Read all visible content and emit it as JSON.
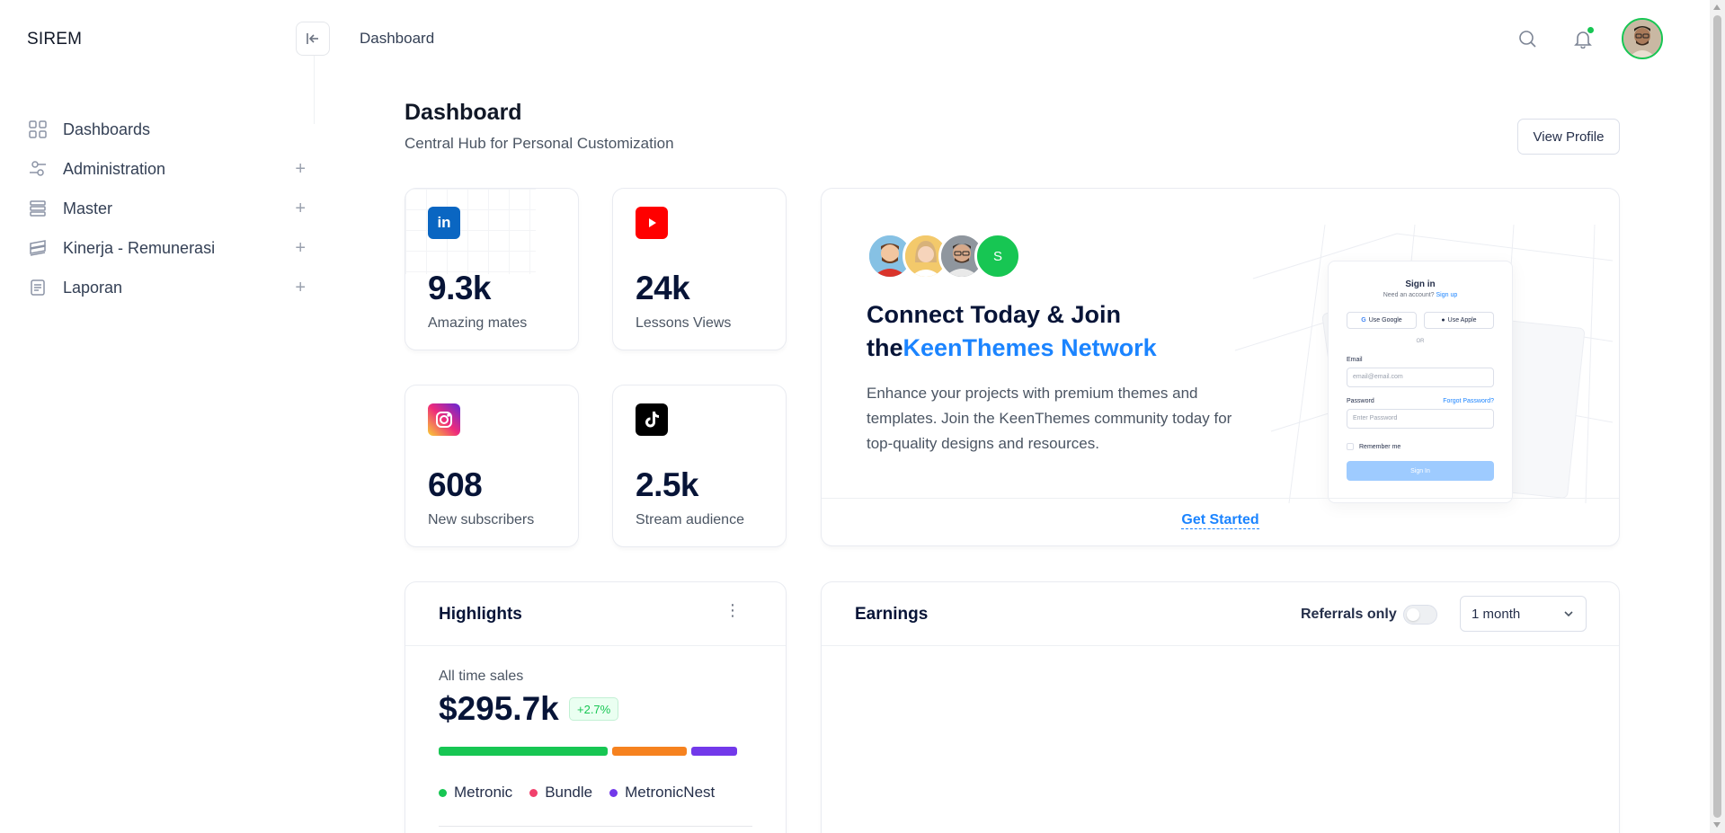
{
  "brand": "SIREM",
  "topbar": {
    "title": "Dashboard"
  },
  "sidebar": {
    "items": [
      {
        "label": "Dashboards",
        "icon": "grid-icon",
        "expandable": false
      },
      {
        "label": "Administration",
        "icon": "sliders-icon",
        "expandable": true
      },
      {
        "label": "Master",
        "icon": "stack-icon",
        "expandable": true
      },
      {
        "label": "Kinerja - Remunerasi",
        "icon": "layers-icon",
        "expandable": true
      },
      {
        "label": "Laporan",
        "icon": "document-icon",
        "expandable": true
      }
    ],
    "expand_symbol": "+"
  },
  "page": {
    "title": "Dashboard",
    "subtitle": "Central Hub for Personal Customization",
    "view_profile": "View Profile"
  },
  "stats": [
    {
      "value": "9.3k",
      "label": "Amazing mates",
      "icon": "linkedin-icon",
      "color": "#0a66c2"
    },
    {
      "value": "24k",
      "label": "Lessons Views",
      "icon": "youtube-icon",
      "color": "#ff0000"
    },
    {
      "value": "608",
      "label": "New subscribers",
      "icon": "instagram-icon",
      "color": "#e1306c"
    },
    {
      "value": "2.5k",
      "label": "Stream audience",
      "icon": "tiktok-icon",
      "color": "#000000"
    }
  ],
  "promo": {
    "title_line1": "Connect Today & Join",
    "title_prefix": "the",
    "title_accent": "KeenThemes Network",
    "text": "Enhance your projects with premium themes and templates. Join the KeenThemes community today for top-quality designs and resources.",
    "cta": "Get Started",
    "avatar_initial": "S",
    "signin": {
      "title": "Sign in",
      "subtitle": "Need an account?",
      "signup": "Sign up",
      "google": "Use Google",
      "apple": "Use Apple",
      "or": "OR",
      "email_label": "Email",
      "email_placeholder": "email@email.com",
      "password_label": "Password",
      "forgot": "Forgot Password?",
      "password_placeholder": "Enter Password",
      "remember": "Remember me",
      "submit": "Sign In"
    }
  },
  "highlights": {
    "title": "Highlights",
    "label": "All time sales",
    "value": "$295.7k",
    "badge": "+2.7%",
    "legend": [
      {
        "name": "Metronic",
        "color": "#17c653",
        "share": 0.555
      },
      {
        "name": "Bundle",
        "color": "#f1416c",
        "share": 0.245
      },
      {
        "name": "MetronicNest",
        "color": "#7239ea",
        "share": 0.15
      }
    ],
    "bar_colors": [
      "#17c653",
      "#f6821f",
      "#7239ea"
    ]
  },
  "earnings": {
    "title": "Earnings",
    "referrals_label": "Referrals only",
    "referrals_on": false,
    "period": "1 month"
  },
  "colors": {
    "accent": "#1b84ff",
    "success": "#17c653"
  }
}
